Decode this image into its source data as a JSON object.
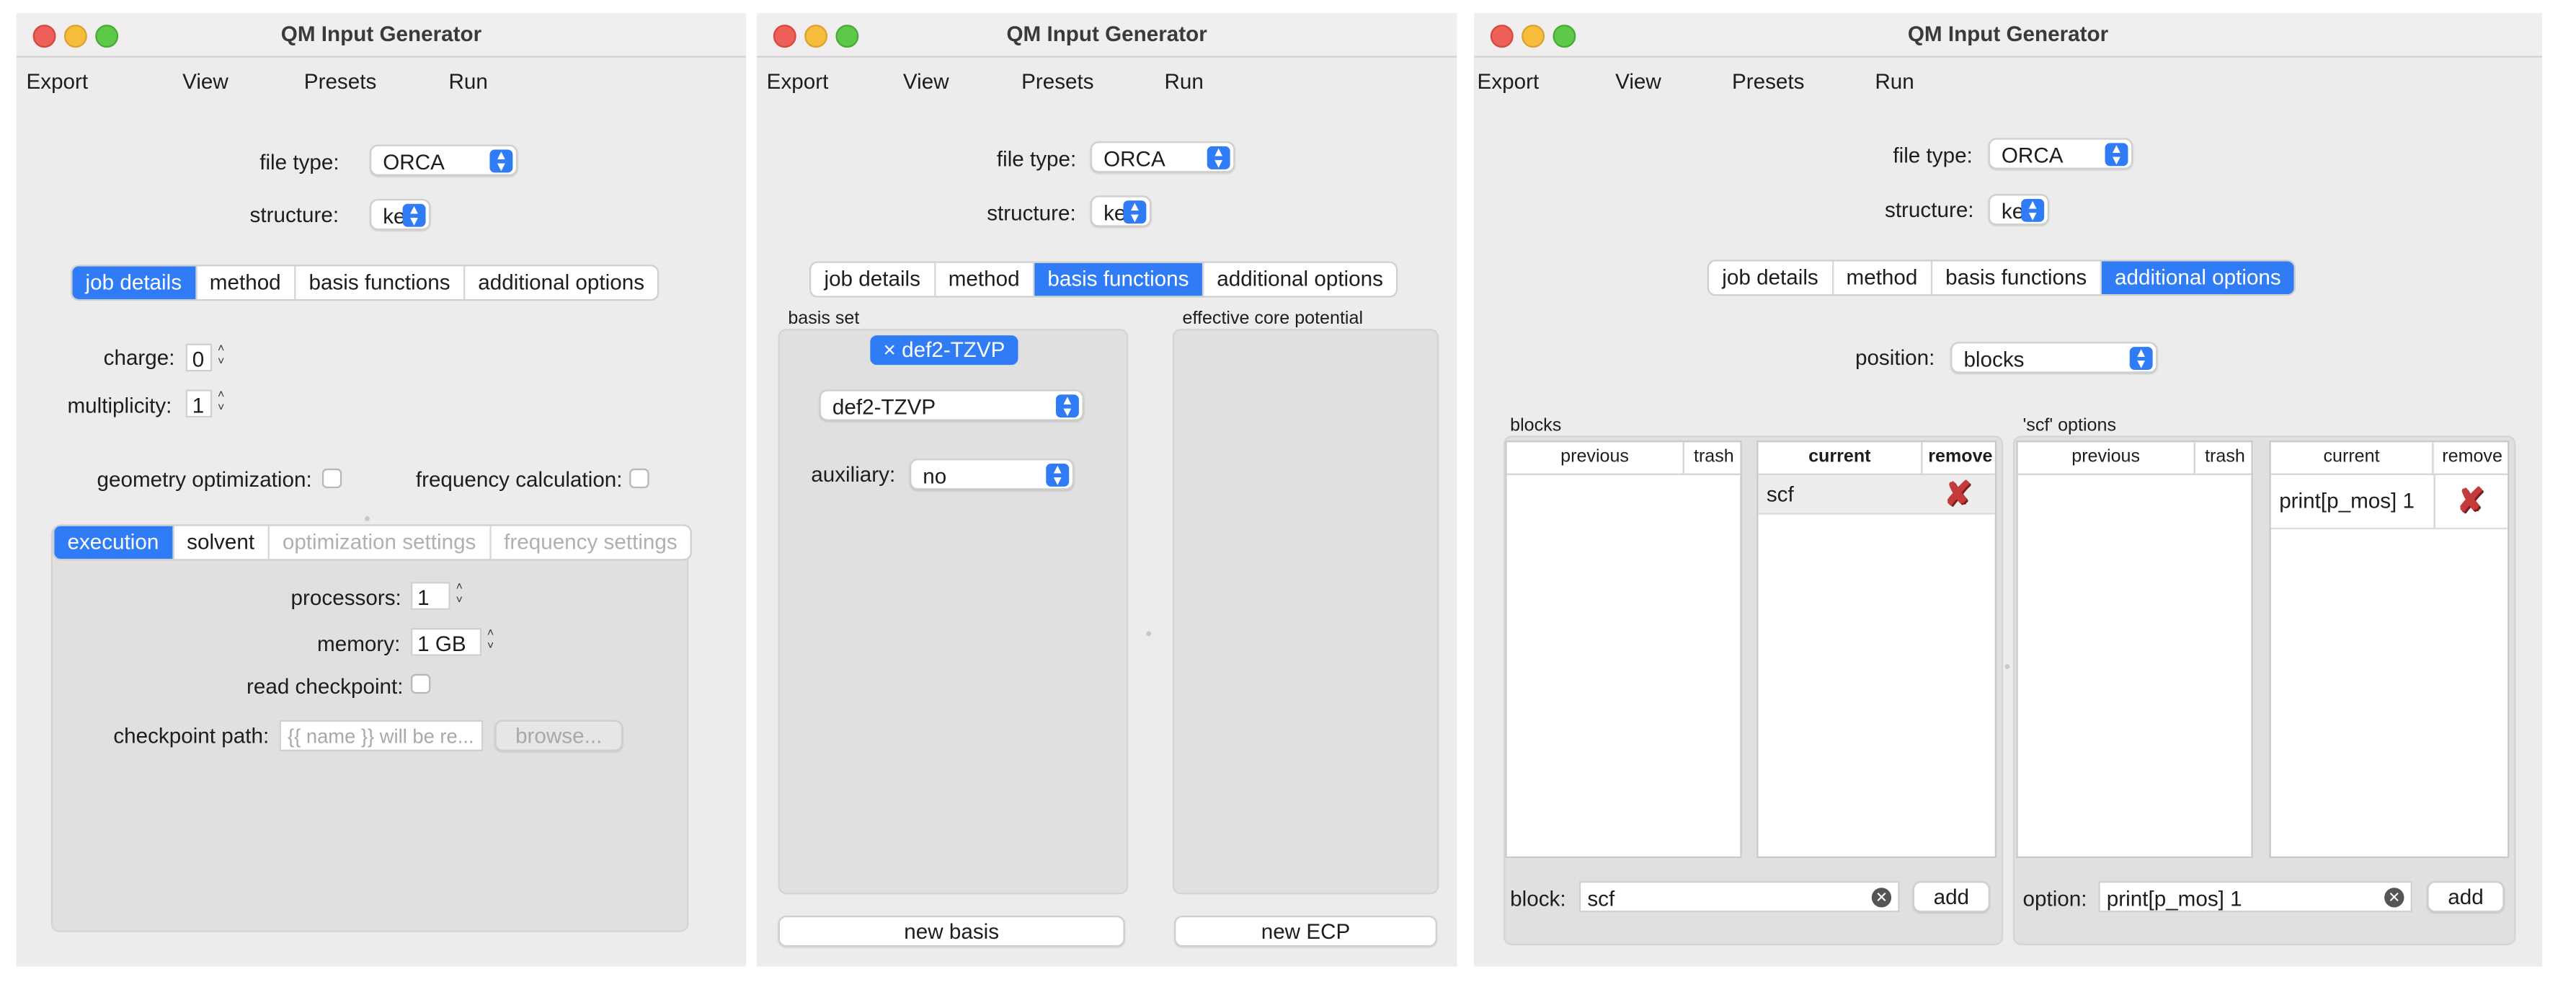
{
  "windows": [
    {
      "title": "QM Input Generator",
      "menu": [
        "Export",
        "View",
        "Presets",
        "Run"
      ],
      "file_type_label": "file type:",
      "file_type_value": "ORCA",
      "structure_label": "structure:",
      "structure_value": "ke",
      "tabs": [
        "job details",
        "method",
        "basis functions",
        "additional options"
      ],
      "active_tab": "job details",
      "charge_label": "charge:",
      "charge_value": "0",
      "multiplicity_label": "multiplicity:",
      "multiplicity_value": "1",
      "geom_opt_label": "geometry optimization:",
      "freq_calc_label": "frequency calculation:",
      "subtabs": [
        "execution",
        "solvent",
        "optimization settings",
        "frequency settings"
      ],
      "active_subtab": "execution",
      "processors_label": "processors:",
      "processors_value": "1",
      "memory_label": "memory:",
      "memory_value": "1 GB",
      "read_checkpoint_label": "read checkpoint:",
      "checkpoint_path_label": "checkpoint path:",
      "checkpoint_path_placeholder": "{{ name }} will be re...",
      "browse_label": "browse..."
    },
    {
      "title": "QM Input Generator",
      "menu": [
        "Export",
        "View",
        "Presets",
        "Run"
      ],
      "file_type_label": "file type:",
      "file_type_value": "ORCA",
      "structure_label": "structure:",
      "structure_value": "ke",
      "tabs": [
        "job details",
        "method",
        "basis functions",
        "additional options"
      ],
      "active_tab": "basis functions",
      "basis_set_label": "basis set",
      "basis_tag": "def2-TZVP",
      "basis_tag_close": "×",
      "basis_select_value": "def2-TZVP",
      "auxiliary_label": "auxiliary:",
      "auxiliary_value": "no",
      "ecp_label": "effective core potential",
      "new_basis_label": "new basis",
      "new_ecp_label": "new ECP"
    },
    {
      "title": "QM Input Generator",
      "menu": [
        "Export",
        "View",
        "Presets",
        "Run"
      ],
      "file_type_label": "file type:",
      "file_type_value": "ORCA",
      "structure_label": "structure:",
      "structure_value": "ke",
      "tabs": [
        "job details",
        "method",
        "basis functions",
        "additional options"
      ],
      "active_tab": "additional options",
      "position_label": "position:",
      "position_value": "blocks",
      "blocks_label": "blocks",
      "blocks_prev_headers": [
        "previous",
        "trash"
      ],
      "blocks_curr_headers": [
        "current",
        "remove"
      ],
      "blocks_current_rows": [
        "scf"
      ],
      "block_input_label": "block:",
      "block_input_value": "scf",
      "add_label": "add",
      "scf_options_label": "'scf' options",
      "opts_prev_headers": [
        "previous",
        "trash"
      ],
      "opts_curr_headers": [
        "current",
        "remove"
      ],
      "opts_current_rows": [
        "print[p_mos] 1"
      ],
      "option_input_label": "option:",
      "option_input_value": "print[p_mos] 1"
    }
  ],
  "colors": {
    "accent": "#2f7cf6",
    "window_bg": "#ececec",
    "remove_mark": "#c53b3b"
  }
}
